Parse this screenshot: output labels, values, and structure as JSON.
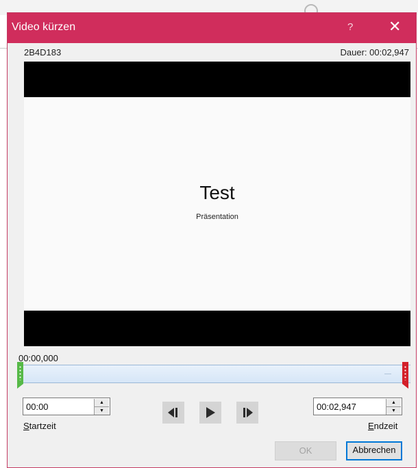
{
  "dialog": {
    "title": "Video kürzen",
    "help_label": "?",
    "close_label": "✕",
    "file_name": "2B4D183",
    "duration_label": "Dauer:",
    "duration_value": "00:02,947"
  },
  "preview": {
    "slide_title": "Test",
    "slide_subtitle": "Präsentation"
  },
  "timeline": {
    "current_time": "00:00,000",
    "start_fraction": 0.0,
    "end_fraction": 1.0
  },
  "start": {
    "value": "00:00",
    "label_mnemonic": "S",
    "label_rest": "tartzeit"
  },
  "end": {
    "value": "00:02,947",
    "label_mnemonic": "E",
    "label_rest": "ndzeit"
  },
  "buttons": {
    "ok": "OK",
    "cancel": "Abbrechen"
  },
  "icons": {
    "prev_frame": "previous-frame-icon",
    "play": "play-icon",
    "next_frame": "next-frame-icon"
  },
  "colors": {
    "titlebar": "#d02d5c",
    "start_marker": "#56b947",
    "end_marker": "#d3202a",
    "focus": "#0078d7"
  }
}
